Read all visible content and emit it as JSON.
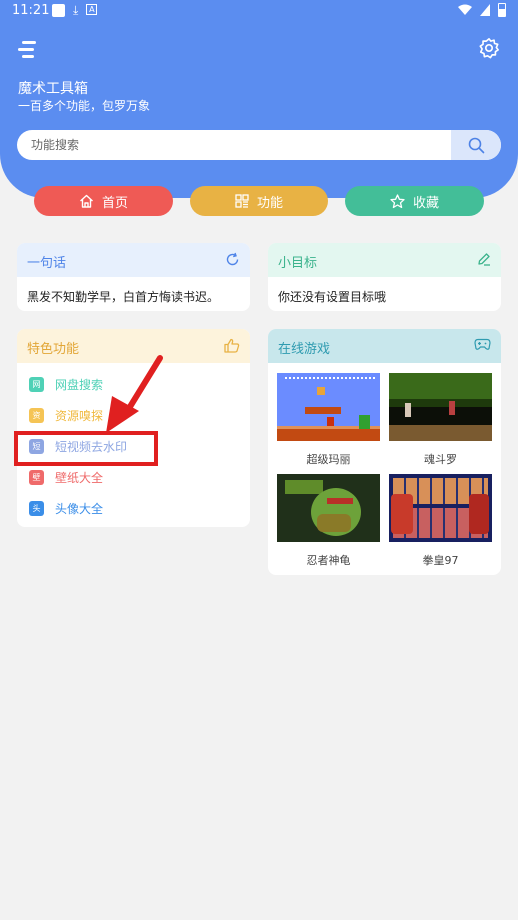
{
  "statusbar": {
    "time": "11:21",
    "download_glyph": "⤓",
    "app_glyph": "A"
  },
  "app": {
    "title": "魔术工具箱",
    "subtitle": "一百多个功能，包罗万象"
  },
  "search": {
    "placeholder": "功能搜索"
  },
  "tabs": [
    {
      "label": "首页",
      "icon": "home-icon"
    },
    {
      "label": "功能",
      "icon": "grid-icon"
    },
    {
      "label": "收藏",
      "icon": "star-icon"
    }
  ],
  "quote_card": {
    "title": "一句话",
    "text": "黑发不知勤学早，白首方悔读书迟。"
  },
  "goal_card": {
    "title": "小目标",
    "text": "你还没有设置目标哦"
  },
  "features_card": {
    "title": "特色功能",
    "items": [
      {
        "badge": "网",
        "label": "网盘搜索",
        "color": "#4fd1b6"
      },
      {
        "badge": "资",
        "label": "资源嗅探",
        "color": "#f5c455"
      },
      {
        "badge": "短",
        "label": "短视频去水印",
        "color": "#8ea6e2"
      },
      {
        "badge": "壁",
        "label": "壁纸大全",
        "color": "#ef6a6a"
      },
      {
        "badge": "头",
        "label": "头像大全",
        "color": "#3b8ee8"
      }
    ]
  },
  "games_card": {
    "title": "在线游戏",
    "games": [
      {
        "name": "超级玛丽"
      },
      {
        "name": "魂斗罗"
      },
      {
        "name": "忍者神龟"
      },
      {
        "name": "拳皇97"
      }
    ]
  },
  "colors": {
    "header": "#5b8df0",
    "home": "#ef5a55",
    "func": "#e8b244",
    "fav": "#43be98"
  }
}
